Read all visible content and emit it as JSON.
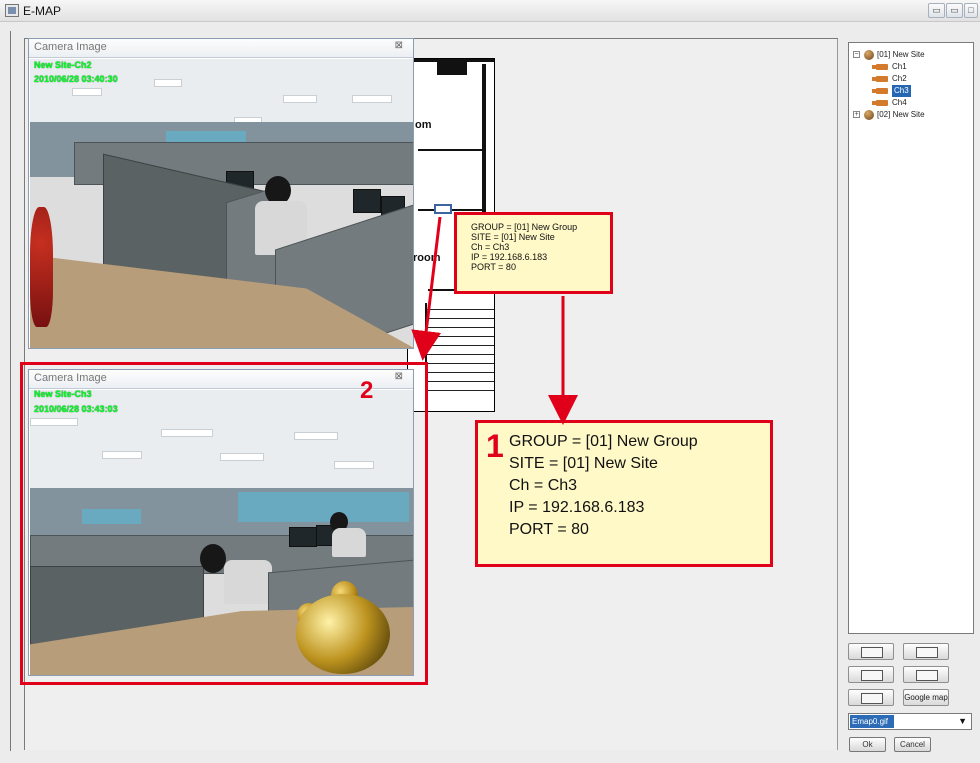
{
  "window": {
    "title": "E-MAP",
    "controls": [
      "▭",
      "▭",
      "□"
    ]
  },
  "cameraWindows": [
    {
      "title": "Camera Image",
      "overlay_site": "New Site-Ch2",
      "overlay_time": "2010/06/28 03:40:30"
    },
    {
      "title": "Camera Image",
      "overlay_site": "New Site-Ch3",
      "overlay_time": "2010/06/28 03:43:03"
    }
  ],
  "map": {
    "room_text_1": "om",
    "room_text_2": "room"
  },
  "smallTooltip": {
    "lines": [
      "GROUP = [01] New Group",
      "SITE = [01] New Site",
      "Ch = Ch3",
      "IP = 192.168.6.183",
      "PORT = 80"
    ]
  },
  "largeTooltip": {
    "number": "1",
    "lines": [
      "GROUP = [01] New Group",
      "SITE = [01] New Site",
      "Ch = Ch3",
      "IP = 192.168.6.183",
      "PORT = 80"
    ]
  },
  "overlayNumbers": {
    "camera": "2"
  },
  "tree": {
    "sites": [
      {
        "label": "[01] New Site",
        "expanded": true
      },
      {
        "label": "[02] New Site",
        "expanded": false
      }
    ],
    "channels": [
      "Ch1",
      "Ch2",
      "Ch3",
      "Ch4"
    ],
    "selected": "Ch3"
  },
  "tools": {
    "google_map": "Google map"
  },
  "mapSelect": {
    "value": "Emap0.gif",
    "arrow": "▼"
  },
  "buttons": {
    "ok": "Ok",
    "cancel": "Cancel"
  },
  "colors": {
    "highlight_red": "#e1001a",
    "tooltip_yellow": "#fff9c8",
    "osd_green": "#00ff22",
    "tree_selection": "#2567b3"
  }
}
